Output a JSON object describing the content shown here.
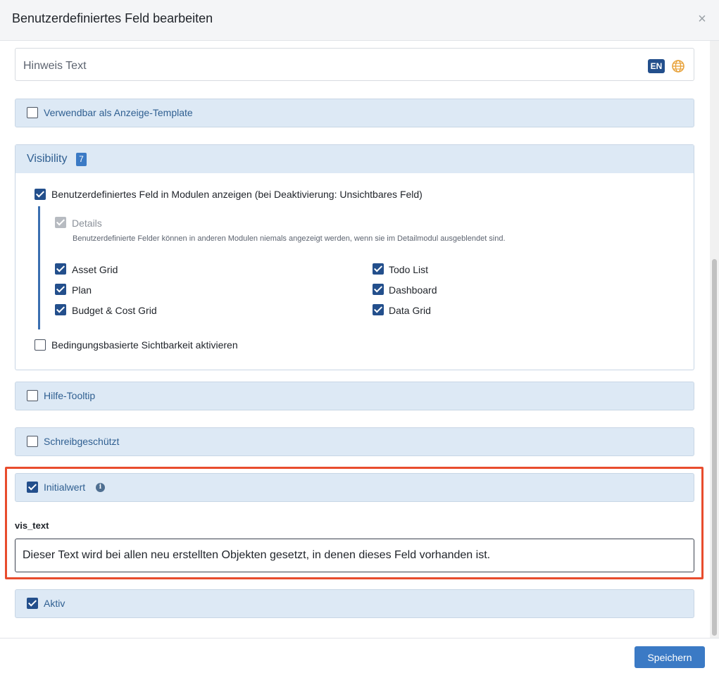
{
  "dialog": {
    "title": "Benutzerdefiniertes Feld bearbeiten",
    "close_glyph": "×",
    "save_label": "Speichern"
  },
  "hint": {
    "label": "Hinweis Text",
    "language_badge": "EN",
    "globe_icon": "globe-icon"
  },
  "template_panel": {
    "label": "Verwendbar als Anzeige-Template",
    "checked": false
  },
  "visibility": {
    "title": "Visibility",
    "count": "7",
    "show_in_modules": {
      "label": "Benutzerdefiniertes Feld in Modulen anzeigen (bei Deaktivierung: Unsichtbares Feld)",
      "checked": true
    },
    "details": {
      "label": "Details",
      "note": "Benutzerdefinierte Felder können in anderen Modulen niemals angezeigt werden, wenn sie im Detailmodul ausgeblendet sind."
    },
    "modules_left": [
      "Asset Grid",
      "Plan",
      "Budget & Cost Grid"
    ],
    "modules_right": [
      "Todo List",
      "Dashboard",
      "Data Grid"
    ],
    "conditional": {
      "label": "Bedingungsbasierte Sichtbarkeit aktivieren",
      "checked": false
    }
  },
  "tooltip_panel": {
    "label": "Hilfe-Tooltip",
    "checked": false
  },
  "readonly_panel": {
    "label": "Schreibgeschützt",
    "checked": false
  },
  "initial_value": {
    "label": "Initialwert",
    "checked": true,
    "info_glyph": "i",
    "field_label": "vis_text",
    "value": "Dieser Text wird bei allen neu erstellten Objekten gesetzt, in denen dieses Feld vorhanden ist."
  },
  "active_panel": {
    "label": "Aktiv",
    "checked": true
  },
  "colors": {
    "accent": "#3b7ac5",
    "checkbox_checked": "#234f8c",
    "panel_bg": "#dde9f5",
    "highlight_border": "#e84c2d"
  }
}
